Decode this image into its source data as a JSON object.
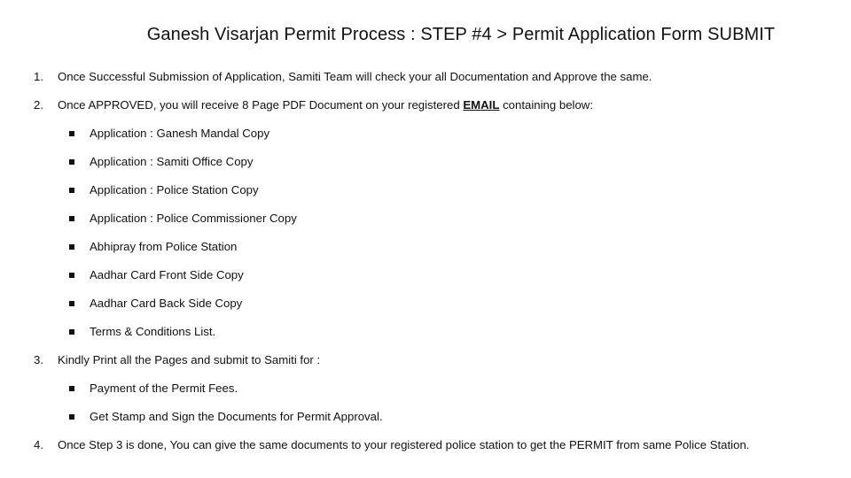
{
  "title": "Ganesh Visarjan Permit Process : STEP #4 > Permit Application Form SUBMIT",
  "steps": [
    {
      "number": "1.",
      "text": "Once Successful Submission of Application, Samiti Team will check your all Documentation and Approve the same."
    },
    {
      "number": "2.",
      "text_before": "Once APPROVED, you will receive 8 Page PDF Document on your registered ",
      "emphasis": "EMAIL",
      "text_after": " containing below:",
      "bullets": [
        "Application : Ganesh Mandal Copy",
        "Application : Samiti Office Copy",
        "Application : Police Station Copy",
        "Application : Police Commissioner Copy",
        "Abhipray from Police Station",
        "Aadhar Card Front Side Copy",
        "Aadhar Card Back Side Copy",
        "Terms & Conditions List."
      ]
    },
    {
      "number": "3.",
      "text": "Kindly Print all the Pages and submit to Samiti for :",
      "bullets": [
        "Payment of the Permit Fees.",
        "Get Stamp and Sign the Documents for Permit Approval."
      ]
    },
    {
      "number": "4.",
      "text": "Once Step 3 is done, You can give the same documents to your registered police station to get the PERMIT from same Police Station."
    }
  ]
}
